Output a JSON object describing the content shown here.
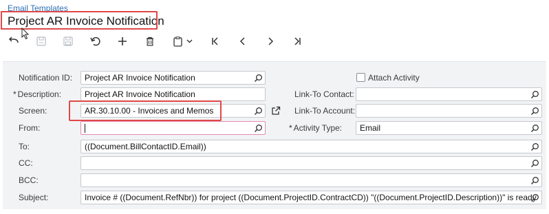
{
  "breadcrumb": "Email Templates",
  "title": "Project AR Invoice Notification",
  "icons": {
    "back": "back-arrow-icon",
    "save_close": "save-close-icon",
    "save": "save-icon",
    "undo": "undo-icon",
    "add": "plus-icon",
    "delete": "trash-icon",
    "copy_paste": "clipboard-icon",
    "dropdown": "chevron-down-icon",
    "first": "first-record-icon",
    "prev": "previous-record-icon",
    "next": "next-record-icon",
    "last": "last-record-icon",
    "search": "magnifier-icon",
    "external": "external-link-icon"
  },
  "form": {
    "notification_id": {
      "label": "Notification ID:",
      "value": "Project AR Invoice Notification"
    },
    "description": {
      "required": "*",
      "label": "Description:",
      "value": "Project AR Invoice Notification"
    },
    "screen": {
      "label": "Screen:",
      "value": "AR.30.10.00 - Invoices and Memos"
    },
    "from": {
      "label": "From:",
      "value": ""
    },
    "attach_activity": {
      "label": "Attach Activity",
      "checked": false
    },
    "link_to_contact": {
      "label": "Link-To Contact:",
      "value": ""
    },
    "link_to_account": {
      "label": "Link-To Account:",
      "value": ""
    },
    "activity_type": {
      "required": "*",
      "label": "Activity Type:",
      "value": "Email"
    },
    "to": {
      "label": "To:",
      "value": "((Document.BillContactID.Email))"
    },
    "cc": {
      "label": "CC:",
      "value": ""
    },
    "bcc": {
      "label": "BCC:",
      "value": ""
    },
    "subject": {
      "label": "Subject:",
      "value": "Invoice # ((Document.RefNbr)) for project ((Document.ProjectID.ContractCD)) \"((Document.ProjectID.Description))\" is ready"
    }
  },
  "colors": {
    "highlight": "#e04848",
    "link": "#2f6fb4",
    "form_bg": "#f2f3f5",
    "focus_border": "#e58ab0"
  }
}
